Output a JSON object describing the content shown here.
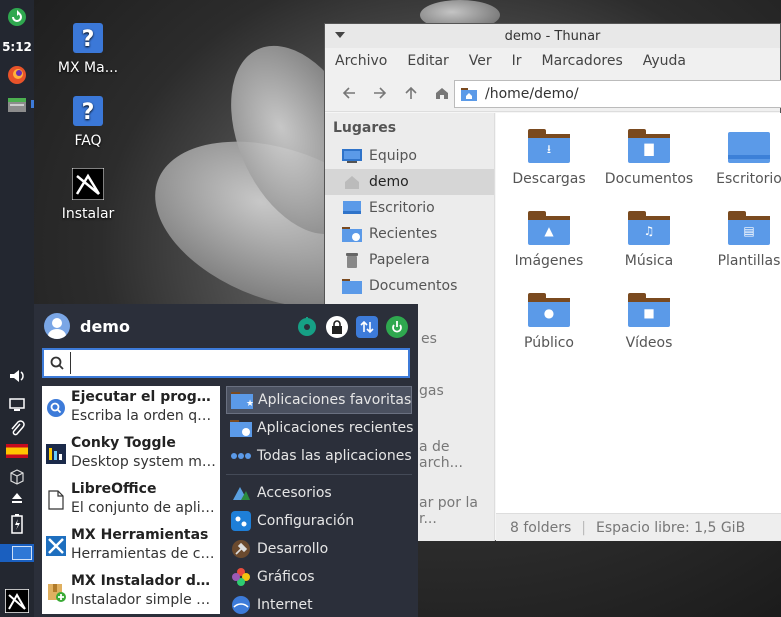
{
  "panel": {
    "clock": "5:12"
  },
  "desktop": {
    "icons": [
      {
        "label": "MX Ma..."
      },
      {
        "label": "FAQ"
      },
      {
        "label": "Instalar"
      }
    ]
  },
  "thunar": {
    "title": "demo - Thunar",
    "menu": [
      "Archivo",
      "Editar",
      "Ver",
      "Ir",
      "Marcadores",
      "Ayuda"
    ],
    "location": "/home/demo/",
    "sidebar_header": "Lugares",
    "places": [
      "Equipo",
      "demo",
      "Escritorio",
      "Recientes",
      "Papelera",
      "Documentos"
    ],
    "hidden_places_fragments": [
      "es",
      "gas",
      "a de arch...",
      "ar por la r..."
    ],
    "folders": [
      {
        "label": "Descargas",
        "glyph": "download-icon"
      },
      {
        "label": "Documentos",
        "glyph": "document-icon"
      },
      {
        "label": "Escritorio",
        "glyph": "desktop-icon"
      },
      {
        "label": "Imágenes",
        "glyph": "image-icon"
      },
      {
        "label": "Música",
        "glyph": "music-icon"
      },
      {
        "label": "Plantillas",
        "glyph": "template-icon"
      },
      {
        "label": "Público",
        "glyph": "person-icon"
      },
      {
        "label": "Vídeos",
        "glyph": "video-icon"
      }
    ],
    "status": {
      "count": "8 folders",
      "free": "Espacio libre: 1,5 GiB"
    }
  },
  "menu": {
    "user": "demo",
    "search_value": "",
    "favorites": [
      {
        "name": "Ejecutar el progra...",
        "desc": "Escriba la orden qu..."
      },
      {
        "name": "Conky Toggle",
        "desc": "Desktop system mo..."
      },
      {
        "name": "LibreOffice",
        "desc": "El conjunto de aplic..."
      },
      {
        "name": "MX Herramientas",
        "desc": "Herramientas de co..."
      },
      {
        "name": "MX Instalador de P...",
        "desc": "Instalador simple d..."
      }
    ],
    "categories_top": [
      "Aplicaciones favoritas",
      "Aplicaciones recientes",
      "Todas las aplicaciones"
    ],
    "categories": [
      "Accesorios",
      "Configuración",
      "Desarrollo",
      "Gráficos",
      "Internet"
    ]
  },
  "colors": {
    "accent": "#3d7bd9",
    "folder": "#5b9ae8",
    "panel": "#232730",
    "menu_bg": "#2b2f3a"
  }
}
